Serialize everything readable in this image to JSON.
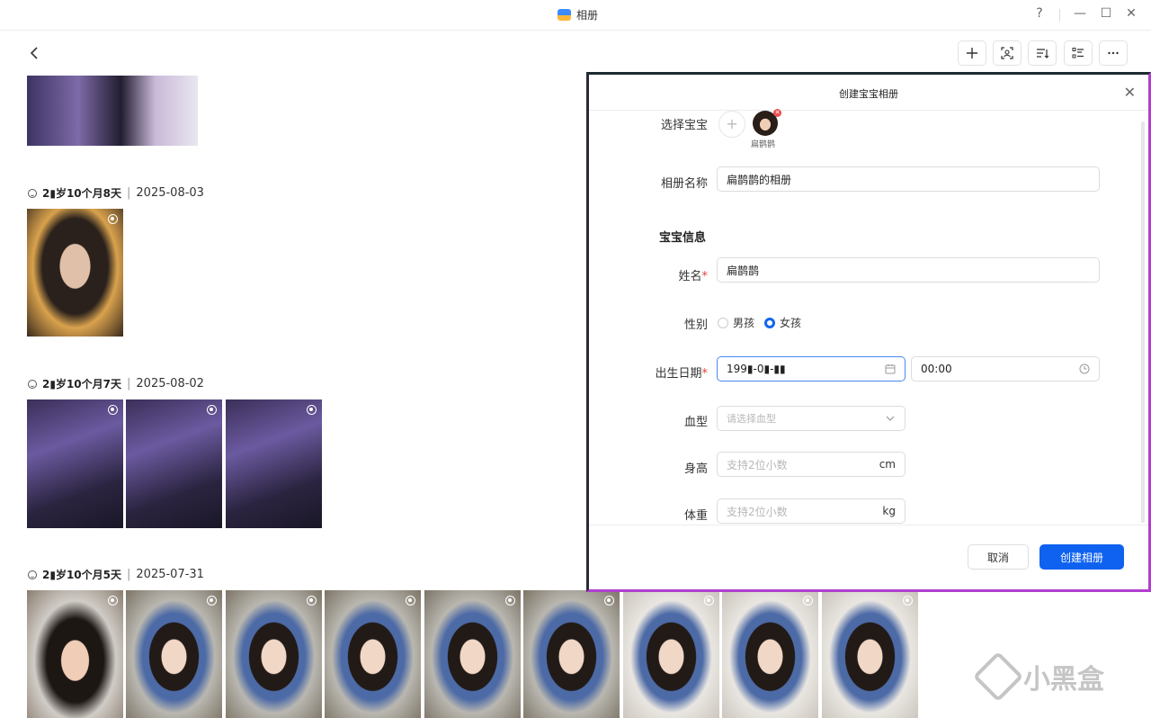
{
  "window": {
    "title": "相册",
    "help": "?",
    "minimize": "—",
    "maximize": "☐",
    "close": "✕"
  },
  "toolbar": {
    "back_icon": "chevron-left-icon",
    "buttons": [
      "add-icon",
      "face-scan-icon",
      "sort-icon",
      "list-view-icon",
      "more-icon"
    ]
  },
  "timeline": [
    {
      "age": "2▮岁10个月8天",
      "separator": "|",
      "date": "2025-08-03"
    },
    {
      "age": "2▮岁10个月7天",
      "separator": "|",
      "date": "2025-08-02"
    },
    {
      "age": "2▮岁10个月5天",
      "separator": "|",
      "date": "2025-07-31"
    }
  ],
  "watermark": {
    "text": "小黑盒"
  },
  "dialog": {
    "title": "创建宝宝相册",
    "close": "✕",
    "select_baby_label": "选择宝宝",
    "add_baby": "+",
    "baby_name": "扁鹊鹊",
    "album_name_label": "相册名称",
    "album_name_value": "扁鹊鹊的相册",
    "section_title": "宝宝信息",
    "name_label": "姓名",
    "name_value": "扁鹊鹊",
    "required_mark": "*",
    "gender_label": "性别",
    "gender_options": [
      "男孩",
      "女孩"
    ],
    "gender_selected": "女孩",
    "birth_label": "出生日期",
    "birth_date_value": "199▮-0▮-▮▮",
    "birth_time_value": "00:00",
    "blood_label": "血型",
    "blood_placeholder": "请选择血型",
    "height_label": "身高",
    "height_placeholder": "支持2位小数",
    "height_unit": "cm",
    "weight_label": "体重",
    "weight_placeholder": "支持2位小数",
    "weight_unit": "kg",
    "cancel": "取消",
    "create": "创建相册"
  },
  "colors": {
    "accent": "#0f62f0",
    "required": "#e0443c",
    "dialog_border": "#b03fcf"
  }
}
